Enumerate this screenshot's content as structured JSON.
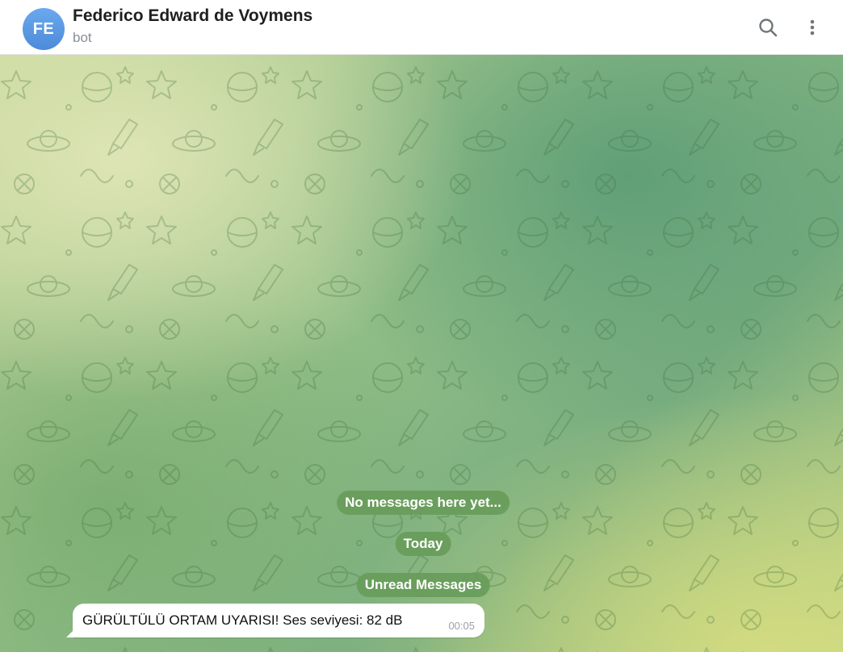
{
  "header": {
    "avatar_initials": "FE",
    "title": "Federico Edward de Voymens",
    "subtitle": "bot",
    "search_icon": "search-icon",
    "more_icon": "more-vertical-icon"
  },
  "chat": {
    "service_messages": [
      "No messages here yet...",
      "Today",
      "Unread Messages"
    ],
    "messages": [
      {
        "text": "GÜRÜLTÜLÜ ORTAM UYARISI! Ses seviyesi: 82 dB",
        "time": "00:05"
      }
    ]
  },
  "colors": {
    "avatar": "#5b9ae6",
    "service_pill": "#689c5a",
    "bubble": "#ffffff",
    "header_bg": "#ffffff"
  }
}
